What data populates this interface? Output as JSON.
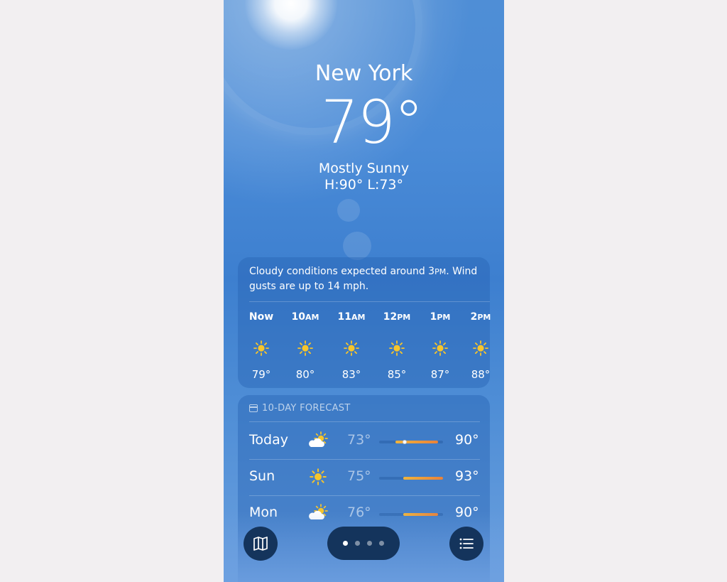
{
  "location": {
    "city": "New York",
    "temperature": "79°",
    "condition": "Mostly Sunny",
    "high_low": "H:90°  L:73°"
  },
  "hourly": {
    "summary_before": "Cloudy conditions expected around 3",
    "summary_pm": "PM",
    "summary_after": ". Wind gusts are up to 14 mph.",
    "hours": [
      {
        "label": "Now",
        "suffix": "",
        "temp": "79°",
        "icon": "sun-icon"
      },
      {
        "label": "10",
        "suffix": "AM",
        "temp": "80°",
        "icon": "sun-icon"
      },
      {
        "label": "11",
        "suffix": "AM",
        "temp": "83°",
        "icon": "sun-icon"
      },
      {
        "label": "12",
        "suffix": "PM",
        "temp": "85°",
        "icon": "sun-icon"
      },
      {
        "label": "1",
        "suffix": "PM",
        "temp": "87°",
        "icon": "sun-icon"
      },
      {
        "label": "2",
        "suffix": "PM",
        "temp": "88°",
        "icon": "sun-icon"
      }
    ]
  },
  "forecast": {
    "header": "10-DAY FORECAST",
    "days": [
      {
        "day": "Today",
        "icon": "partly-cloudy-icon",
        "low": "73°",
        "high": "90°",
        "bar_start": 0.25,
        "bar_end": 0.92,
        "current": 0.4
      },
      {
        "day": "Sun",
        "icon": "sun-icon",
        "low": "75°",
        "high": "93°",
        "bar_start": 0.38,
        "bar_end": 1.0
      },
      {
        "day": "Mon",
        "icon": "partly-cloudy-icon",
        "low": "76°",
        "high": "90°",
        "bar_start": 0.38,
        "bar_end": 0.92
      }
    ]
  },
  "toolbar": {
    "map_icon": "map-icon",
    "list_icon": "list-icon",
    "pages": 4,
    "active_page": 0
  },
  "colors": {
    "sun": "#f7c52a",
    "bar_warm": "#e9823a",
    "bar_yellow": "#f1b43b",
    "toolbar": "#14345c"
  }
}
